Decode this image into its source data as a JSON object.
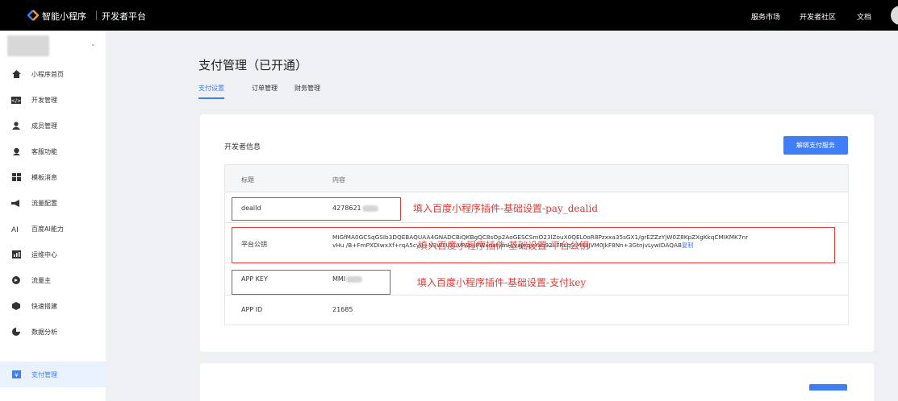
{
  "topbar": {
    "brand": "智能小程序",
    "subtitle": "开发者平台",
    "nav": [
      "服务市场",
      "开发者社区",
      "文档"
    ]
  },
  "sidebar": {
    "items": [
      {
        "label": "小程序首页",
        "icon": "home-icon"
      },
      {
        "label": "开发管理",
        "icon": "code-icon"
      },
      {
        "label": "成员管理",
        "icon": "person-icon"
      },
      {
        "label": "客服功能",
        "icon": "headset-icon"
      },
      {
        "label": "模板消息",
        "icon": "template-icon"
      },
      {
        "label": "流量配置",
        "icon": "megaphone-icon"
      },
      {
        "label": "百度AI能力",
        "icon": "ai-icon"
      },
      {
        "label": "运维中心",
        "icon": "bar-chart-icon"
      },
      {
        "label": "流量主",
        "icon": "traffic-icon"
      },
      {
        "label": "快速搭建",
        "icon": "build-icon"
      },
      {
        "label": "数据分析",
        "icon": "pie-chart-icon"
      },
      {
        "label": "支付管理",
        "icon": "payment-icon",
        "active": true
      }
    ]
  },
  "page": {
    "title": "支付管理（已开通）",
    "tabs": [
      {
        "label": "支付设置",
        "active": true
      },
      {
        "label": "订单管理"
      },
      {
        "label": "财务管理"
      }
    ]
  },
  "card": {
    "title": "开发者信息",
    "unbind_label": "解绑支付服务",
    "headers": {
      "key": "标题",
      "value": "内容"
    },
    "rows": [
      {
        "key": "dealId",
        "value": "4278621"
      },
      {
        "key": "平台公钥",
        "value_line1": "MIGfMA0GCSqGSIb3DQEBAQUAA4GNADCBiQKBgQC8sOp2AoGESCSmO23lZouX0QEL0oR8Pzxxa35sGX1/grEZZzYjW0Z8KpZXgKkqCMIKMK7nr",
        "value_line2": "vHu           /B+FmPXDIwxXf+rqA5cy4+N3WIlUKuVFApuPWxnatymH/vaJeqjzYaq92Il7RcqSIM4aJVM0JkF8Nn+3GtnjvLywIDAQAB",
        "copy_label": "复制"
      },
      {
        "key": "APP KEY",
        "value": "MMI"
      },
      {
        "key": "APP ID",
        "value": "21685"
      }
    ]
  },
  "annotations": {
    "dealid_note": "填入百度小程序插件-基础设置-pay_dealid",
    "pubkey_note": "填入百度小程序插件-基础设置-平台公钥",
    "appkey_note": "填入百度小程序插件-基础设置-支付key"
  },
  "colors": {
    "accent": "#3f7ef6",
    "annotation": "#e53935",
    "topbar": "#000000"
  }
}
